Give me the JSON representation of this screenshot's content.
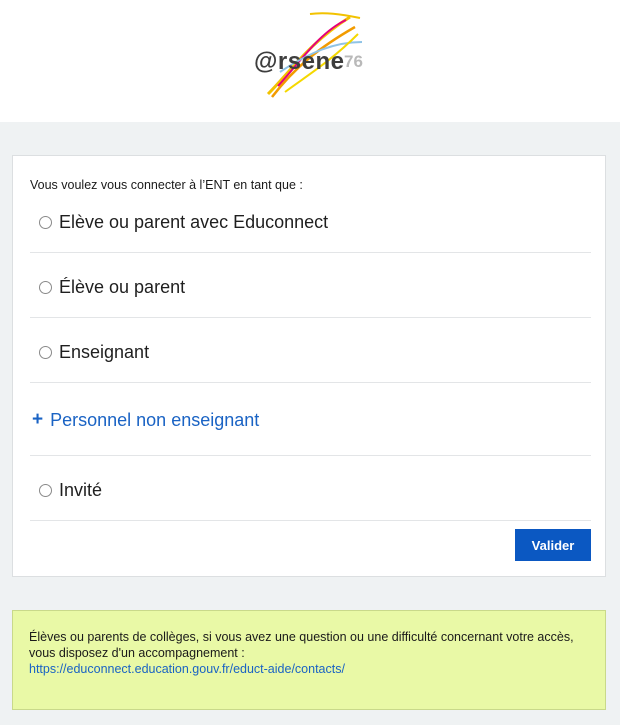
{
  "header": {
    "logo_text": "@rsene",
    "logo_number": "76",
    "colors": {
      "brand_text": "#3d3d3d",
      "brand_number": "#b9b9b9"
    }
  },
  "login": {
    "prompt": "Vous voulez vous connecter à l’ENT en tant que :",
    "options": [
      {
        "label": "Elève ou parent avec Educonnect",
        "selected": false
      },
      {
        "label": "Élève ou parent",
        "selected": false
      },
      {
        "label": "Enseignant",
        "selected": false
      },
      {
        "label": "Personnel non enseignant",
        "expandable": true,
        "icon": "plus-icon"
      },
      {
        "label": "Invité",
        "selected": false
      }
    ],
    "submit_label": "Valider"
  },
  "notice": {
    "text": "Élèves ou parents de collèges, si vous avez une question ou une difficulté concernant votre accès, vous disposez d'un accompagnement :",
    "link": "https://educonnect.education.gouv.fr/educt-aide/contacts/"
  },
  "colors": {
    "accent": "#0b58c2",
    "link": "#1a63c4",
    "page_background": "#eff2f3",
    "notice_background": "#e9f9a6"
  }
}
